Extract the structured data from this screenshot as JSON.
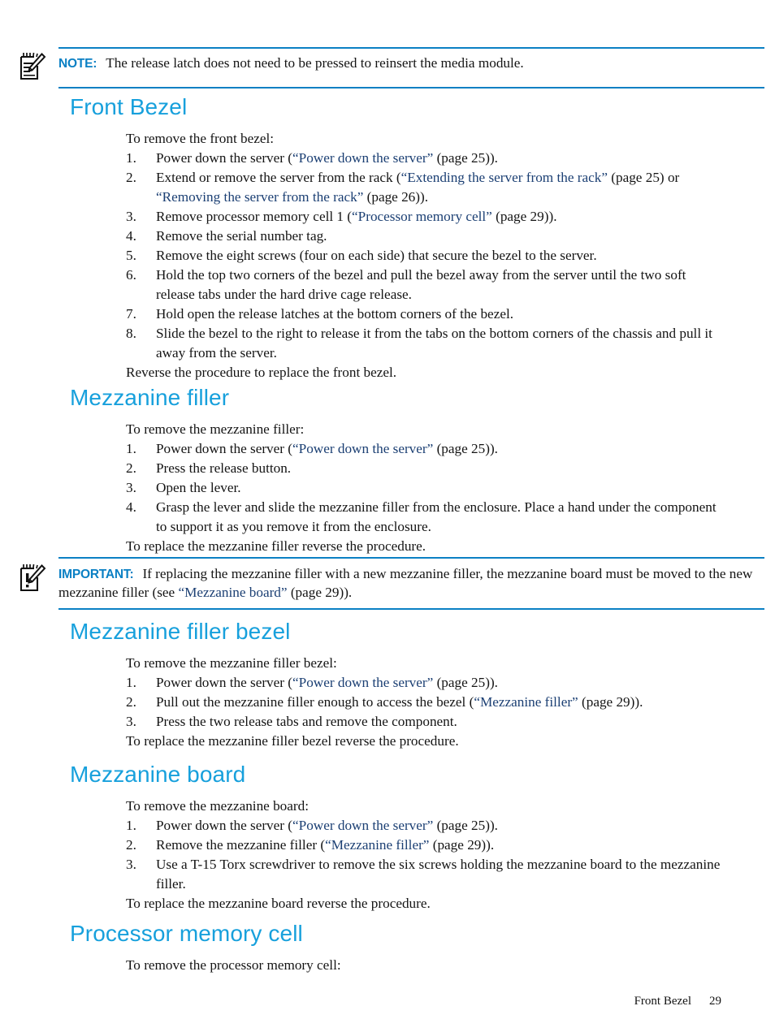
{
  "page": {
    "footer_title": "Front Bezel",
    "footer_page_number": "29",
    "heading_color": "#17a0dc",
    "link_color": "#1b3f73",
    "rule_color": "#0b80c4",
    "body_color": "#141414"
  },
  "note": {
    "icon": "note-pad-pencil-icon",
    "label": "NOTE:",
    "text": "The release latch does not need to be pressed to reinsert the media module."
  },
  "important": {
    "icon": "important-pad-pencil-icon",
    "label": "IMPORTANT:",
    "text_before_link": "If replacing the mezzanine filler with a new mezzanine filler, the mezzanine board must be moved to the new mezzanine filler (see ",
    "link": "“Mezzanine board”",
    "text_after_link": " (page 29))."
  },
  "sections": {
    "front_bezel": {
      "heading": "Front Bezel",
      "intro": "To remove the front bezel:",
      "steps": [
        {
          "num": "1.",
          "parts": [
            {
              "t": "Power down the server (",
              "k": "text"
            },
            {
              "t": "“Power down the server”",
              "k": "link"
            },
            {
              "t": " (page 25)).",
              "k": "text"
            }
          ]
        },
        {
          "num": "2.",
          "parts": [
            {
              "t": "Extend or remove the server from the rack (",
              "k": "text"
            },
            {
              "t": "“Extending the server from the rack”",
              "k": "link"
            },
            {
              "t": " (page 25) or ",
              "k": "text"
            },
            {
              "t": "“Removing the server from the rack”",
              "k": "link"
            },
            {
              "t": " (page 26)).",
              "k": "text"
            }
          ]
        },
        {
          "num": "3.",
          "parts": [
            {
              "t": "Remove processor memory cell 1 (",
              "k": "text"
            },
            {
              "t": "“Processor memory cell”",
              "k": "link"
            },
            {
              "t": " (page 29)).",
              "k": "text"
            }
          ]
        },
        {
          "num": "4.",
          "parts": [
            {
              "t": "Remove the serial number tag.",
              "k": "text"
            }
          ]
        },
        {
          "num": "5.",
          "parts": [
            {
              "t": "Remove the eight screws (four on each side) that secure the bezel to the server.",
              "k": "text"
            }
          ]
        },
        {
          "num": "6.",
          "parts": [
            {
              "t": "Hold the top two corners of the bezel and pull the bezel away from the server until the two soft release tabs under the hard drive cage release.",
              "k": "text"
            }
          ]
        },
        {
          "num": "7.",
          "parts": [
            {
              "t": "Hold open the release latches at the bottom corners of the bezel.",
              "k": "text"
            }
          ]
        },
        {
          "num": "8.",
          "parts": [
            {
              "t": "Slide the bezel to the right to release it from the tabs on the bottom corners of the chassis and pull it away from the server.",
              "k": "text"
            }
          ]
        }
      ],
      "outro": "Reverse the procedure to replace the front bezel."
    },
    "mezzanine_filler": {
      "heading": "Mezzanine filler",
      "intro": "To remove the mezzanine filler:",
      "steps": [
        {
          "num": "1.",
          "parts": [
            {
              "t": "Power down the server (",
              "k": "text"
            },
            {
              "t": "“Power down the server”",
              "k": "link"
            },
            {
              "t": " (page 25)).",
              "k": "text"
            }
          ]
        },
        {
          "num": "2.",
          "parts": [
            {
              "t": "Press the release button.",
              "k": "text"
            }
          ]
        },
        {
          "num": "3.",
          "parts": [
            {
              "t": "Open the lever.",
              "k": "text"
            }
          ]
        },
        {
          "num": "4.",
          "parts": [
            {
              "t": "Grasp the lever and slide the mezzanine filler from the enclosure. Place a hand under the component to support it as you remove it from the enclosure.",
              "k": "text"
            }
          ]
        }
      ],
      "outro": "To replace the mezzanine filler reverse the procedure."
    },
    "mezzanine_filler_bezel": {
      "heading": "Mezzanine filler bezel",
      "intro": "To remove the mezzanine filler bezel:",
      "steps": [
        {
          "num": "1.",
          "parts": [
            {
              "t": "Power down the server (",
              "k": "text"
            },
            {
              "t": "“Power down the server”",
              "k": "link"
            },
            {
              "t": " (page 25)).",
              "k": "text"
            }
          ]
        },
        {
          "num": "2.",
          "parts": [
            {
              "t": "Pull out the mezzanine filler enough to access the bezel (",
              "k": "text"
            },
            {
              "t": "“Mezzanine filler”",
              "k": "link"
            },
            {
              "t": " (page 29)).",
              "k": "text"
            }
          ]
        },
        {
          "num": "3.",
          "parts": [
            {
              "t": "Press the two release tabs and remove the component.",
              "k": "text"
            }
          ]
        }
      ],
      "outro": "To replace the mezzanine filler bezel reverse the procedure."
    },
    "mezzanine_board": {
      "heading": "Mezzanine board",
      "intro": "To remove the mezzanine board:",
      "steps": [
        {
          "num": "1.",
          "parts": [
            {
              "t": "Power down the server (",
              "k": "text"
            },
            {
              "t": "“Power down the server”",
              "k": "link"
            },
            {
              "t": " (page 25)).",
              "k": "text"
            }
          ]
        },
        {
          "num": "2.",
          "parts": [
            {
              "t": "Remove the mezzanine filler (",
              "k": "text"
            },
            {
              "t": "“Mezzanine filler”",
              "k": "link"
            },
            {
              "t": " (page 29)).",
              "k": "text"
            }
          ]
        },
        {
          "num": "3.",
          "parts": [
            {
              "t": "Use a T-15 Torx screwdriver to remove the six screws holding the mezzanine board to the mezzanine filler.",
              "k": "text"
            }
          ]
        }
      ],
      "outro": "To replace the mezzanine board reverse the procedure."
    },
    "processor_memory_cell": {
      "heading": "Processor memory cell",
      "intro": "To remove the processor memory cell:",
      "steps": [],
      "outro": ""
    }
  }
}
